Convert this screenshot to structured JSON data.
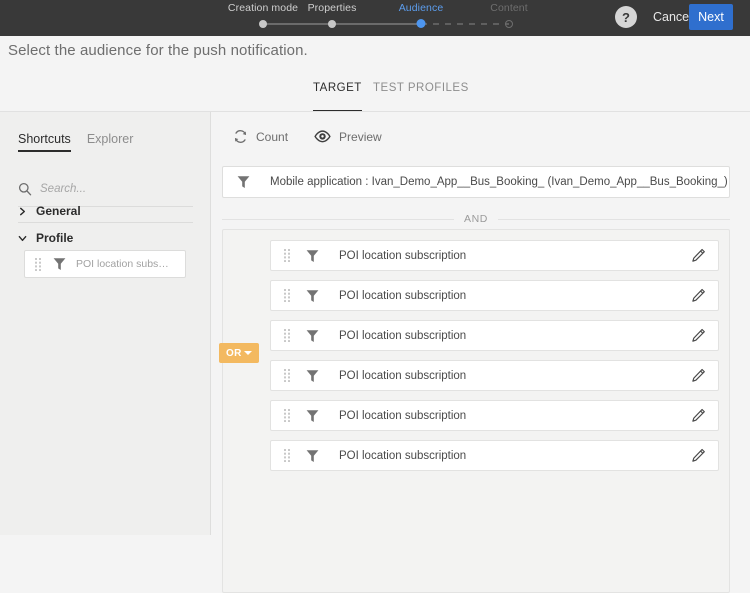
{
  "header": {
    "steps": [
      {
        "label": "Creation mode",
        "state": "done"
      },
      {
        "label": "Properties",
        "state": "done"
      },
      {
        "label": "Audience",
        "state": "active"
      },
      {
        "label": "Content",
        "state": "future"
      }
    ],
    "help_label": "?",
    "cancel_label": "Cancel",
    "next_label": "Next",
    "bar_color": "#393939",
    "accent_color": "#2f6fce",
    "active_step_color": "#5c9ded"
  },
  "page": {
    "title": "Select the audience for the push notification."
  },
  "tabs": [
    {
      "label": "TARGET",
      "active": true
    },
    {
      "label": "TEST PROFILES",
      "active": false
    }
  ],
  "sidebar": {
    "tabs": [
      {
        "label": "Shortcuts",
        "active": true
      },
      {
        "label": "Explorer",
        "active": false
      }
    ],
    "search": {
      "placeholder": "Search...",
      "value": ""
    },
    "groups": [
      {
        "label": "General",
        "expanded": false
      },
      {
        "label": "Profile",
        "expanded": true
      }
    ],
    "chip": {
      "label": "POI location subscriptio···"
    }
  },
  "main": {
    "toolbar": {
      "count_label": "Count",
      "preview_label": "Preview"
    },
    "app_filter": {
      "text": "Mobile application : Ivan_Demo_App__Bus_Booking_  (Ivan_Demo_App__Bus_Booking_)"
    },
    "operator_and": "AND",
    "operator_or": "OR",
    "or_badge_color": "#f3b960",
    "rules": [
      {
        "label": "POI location subscription"
      },
      {
        "label": "POI location subscription"
      },
      {
        "label": "POI location subscription"
      },
      {
        "label": "POI location subscription"
      },
      {
        "label": "POI location subscription"
      },
      {
        "label": "POI location subscription"
      }
    ]
  }
}
